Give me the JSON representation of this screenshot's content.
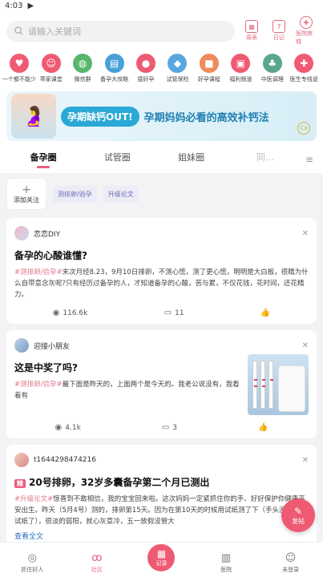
{
  "status": {
    "time": "4:03",
    "indicator": "▶"
  },
  "search": {
    "placeholder": "请输入关键词"
  },
  "top_tools": [
    {
      "label": "周表",
      "icon": "calendar-icon"
    },
    {
      "label": "日记",
      "icon": "diary-icon"
    },
    {
      "label": "医院商城",
      "icon": "hospital-icon"
    }
  ],
  "icon_grid": [
    {
      "label": "一个都不能少",
      "icon": "baby-logo-icon",
      "color": "#ef5a73"
    },
    {
      "label": "乖家课堂",
      "icon": "mom-icon",
      "color": "#ef5a73"
    },
    {
      "label": "微信群",
      "icon": "wechat-icon",
      "color": "#58b66b"
    },
    {
      "label": "备孕大攻略",
      "icon": "book-icon",
      "color": "#4a9fd8"
    },
    {
      "label": "接好孕",
      "icon": "drop-icon",
      "color": "#ef5a73"
    },
    {
      "label": "试管保险",
      "icon": "shield-icon",
      "color": "#5aa7e0"
    },
    {
      "label": "好孕课程",
      "icon": "gift-icon",
      "color": "#ef8a5a"
    },
    {
      "label": "福利频道",
      "icon": "coupon-icon",
      "color": "#ef5a73"
    },
    {
      "label": "中医调理",
      "icon": "herb-icon",
      "color": "#5aa78a"
    },
    {
      "label": "医生专线说",
      "icon": "doctor-icon",
      "color": "#ef5a73"
    }
  ],
  "banner": {
    "pill": "孕期缺钙OUT!",
    "text": "孕期妈妈必看的高效补钙法",
    "badge": "Ca"
  },
  "tabs": [
    {
      "label": "备孕圈"
    },
    {
      "label": "试管圈"
    },
    {
      "label": "姐妹圈"
    },
    {
      "label": "同…"
    }
  ],
  "tab_more": "≡",
  "filters": {
    "add_label": "添加关注",
    "add_symbol": "+",
    "chips": [
      "测排卵/验孕",
      "升级论文"
    ]
  },
  "posts": [
    {
      "username": "恋恋DIY",
      "title": "备孕的心酸谁懂?",
      "tag": "#测排卵/验孕#",
      "body": "末次月经8.23，9月10日排卵，不测心慌，测了更心慌，明明是大白板，很睛为什么自带意念灰呢?只有经历过备孕的人，才知道备孕的心酸，苦与累，不仅花钱，花时间，还花精力。",
      "views": "116.6k",
      "comments": "11"
    },
    {
      "username": "迎接小朋友",
      "title": "这是中奖了吗?",
      "tag": "#测排卵/验孕#",
      "body": "最下面是昨天的，上面两个是今天的。我老公说没有，我看着有",
      "views": "4.1k",
      "comments": "3"
    },
    {
      "username": "t1644298474216",
      "hot": "精",
      "title": "20号排卵，32岁多囊备孕第二个月已测出",
      "tag": "#升级论文#",
      "body": "惊喜到不敢相信，我的宝宝回来啦。这次妈妈一定紧抓住你的手、好好保护你健康平安出生。昨天（5月4号）测的，排卵第15天。因为在第10天的时候用试纸测了下（手头没有早孕试纸了），很淡的弱阳，就心灰意冷，五一放假没管大",
      "see_all": "查看全文"
    }
  ],
  "fab": {
    "label": "发帖"
  },
  "bottom_nav": [
    {
      "label": "抓住好人"
    },
    {
      "label": "社区"
    },
    {
      "label": "记录"
    },
    {
      "label": "医院"
    },
    {
      "label": "未登录"
    }
  ]
}
